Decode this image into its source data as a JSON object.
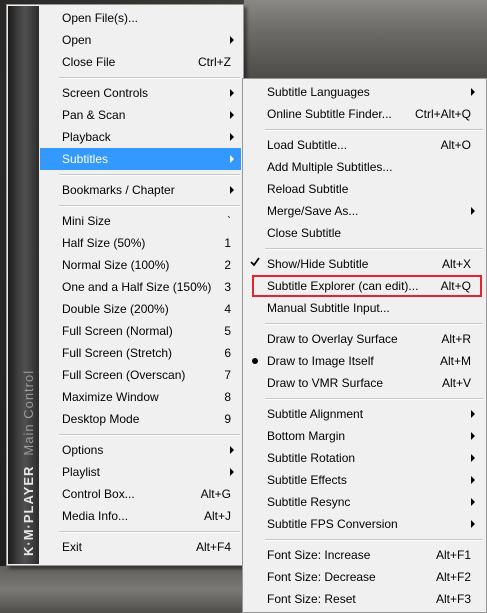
{
  "brand": {
    "name": "K·M·PLAYER",
    "subtitle": "Main Control"
  },
  "main_menu": {
    "items": [
      {
        "label": "Open File(s)...",
        "shortcut": "",
        "arrow": false
      },
      {
        "label": "Open",
        "shortcut": "",
        "arrow": true
      },
      {
        "label": "Close File",
        "shortcut": "Ctrl+Z",
        "arrow": false
      },
      {
        "label": "Screen Controls",
        "shortcut": "",
        "arrow": true
      },
      {
        "label": "Pan & Scan",
        "shortcut": "",
        "arrow": true
      },
      {
        "label": "Playback",
        "shortcut": "",
        "arrow": true
      },
      {
        "label": "Subtitles",
        "shortcut": "",
        "arrow": true
      },
      {
        "label": "Bookmarks / Chapter",
        "shortcut": "",
        "arrow": true
      },
      {
        "label": "Mini Size",
        "shortcut": "`",
        "arrow": false
      },
      {
        "label": "Half Size (50%)",
        "shortcut": "1",
        "arrow": false
      },
      {
        "label": "Normal Size (100%)",
        "shortcut": "2",
        "arrow": false
      },
      {
        "label": "One and a Half Size (150%)",
        "shortcut": "3",
        "arrow": false
      },
      {
        "label": "Double Size (200%)",
        "shortcut": "4",
        "arrow": false
      },
      {
        "label": "Full Screen (Normal)",
        "shortcut": "5",
        "arrow": false
      },
      {
        "label": "Full Screen (Stretch)",
        "shortcut": "6",
        "arrow": false
      },
      {
        "label": "Full Screen (Overscan)",
        "shortcut": "7",
        "arrow": false
      },
      {
        "label": "Maximize Window",
        "shortcut": "8",
        "arrow": false
      },
      {
        "label": "Desktop Mode",
        "shortcut": "9",
        "arrow": false
      },
      {
        "label": "Options",
        "shortcut": "",
        "arrow": true
      },
      {
        "label": "Playlist",
        "shortcut": "",
        "arrow": true
      },
      {
        "label": "Control Box...",
        "shortcut": "Alt+G",
        "arrow": false
      },
      {
        "label": "Media Info...",
        "shortcut": "Alt+J",
        "arrow": false
      },
      {
        "label": "Exit",
        "shortcut": "Alt+F4",
        "arrow": false
      }
    ],
    "selected": "Subtitles"
  },
  "subtitles_menu": {
    "items": [
      {
        "label": "Subtitle Languages",
        "shortcut": "",
        "arrow": true
      },
      {
        "label": "Online Subtitle Finder...",
        "shortcut": "Ctrl+Alt+Q",
        "arrow": false
      },
      {
        "label": "Load Subtitle...",
        "shortcut": "Alt+O",
        "arrow": false
      },
      {
        "label": "Add Multiple Subtitles...",
        "shortcut": "",
        "arrow": false
      },
      {
        "label": "Reload Subtitle",
        "shortcut": "",
        "arrow": false
      },
      {
        "label": "Merge/Save As...",
        "shortcut": "",
        "arrow": true
      },
      {
        "label": "Close Subtitle",
        "shortcut": "",
        "arrow": false
      },
      {
        "label": "Show/Hide Subtitle",
        "shortcut": "Alt+X",
        "arrow": false,
        "checked": true
      },
      {
        "label": "Subtitle Explorer (can edit)...",
        "shortcut": "Alt+Q",
        "arrow": false,
        "highlighted": true
      },
      {
        "label": "Manual Subtitle Input...",
        "shortcut": "",
        "arrow": false
      },
      {
        "label": "Draw to Overlay Surface",
        "shortcut": "Alt+R",
        "arrow": false
      },
      {
        "label": "Draw to Image Itself",
        "shortcut": "Alt+M",
        "arrow": false,
        "radio_selected": true
      },
      {
        "label": "Draw to VMR Surface",
        "shortcut": "Alt+V",
        "arrow": false
      },
      {
        "label": "Subtitle Alignment",
        "shortcut": "",
        "arrow": true
      },
      {
        "label": "Bottom Margin",
        "shortcut": "",
        "arrow": true
      },
      {
        "label": "Subtitle Rotation",
        "shortcut": "",
        "arrow": true
      },
      {
        "label": "Subtitle Effects",
        "shortcut": "",
        "arrow": true
      },
      {
        "label": "Subtitle Resync",
        "shortcut": "",
        "arrow": true
      },
      {
        "label": "Subtitle FPS Conversion",
        "shortcut": "",
        "arrow": true
      },
      {
        "label": "Font Size: Increase",
        "shortcut": "Alt+F1",
        "arrow": false
      },
      {
        "label": "Font Size: Decrease",
        "shortcut": "Alt+F2",
        "arrow": false
      },
      {
        "label": "Font Size: Reset",
        "shortcut": "Alt+F3",
        "arrow": false
      }
    ]
  },
  "colors": {
    "selection": "#3399ff",
    "highlight_box": "#e4232c",
    "menu_bg": "#f0f0f0"
  }
}
